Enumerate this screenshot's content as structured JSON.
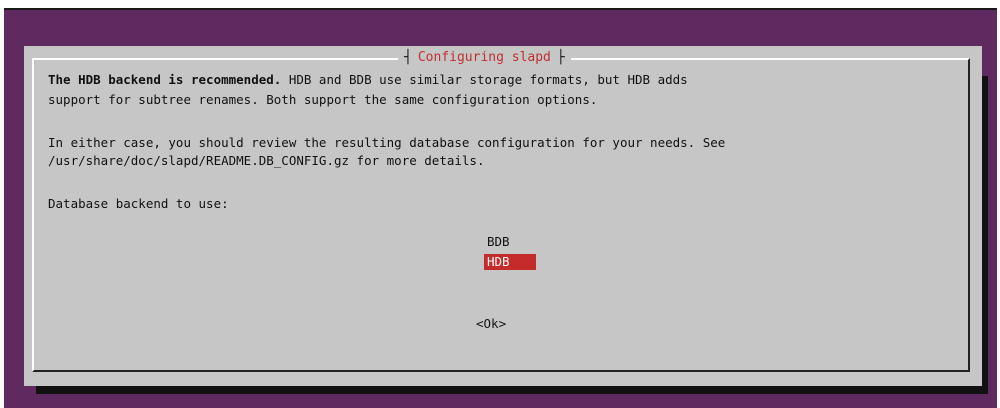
{
  "dialog": {
    "title": "Configuring slapd",
    "paragraph1": {
      "line1_bold": "The HDB backend is recommended.",
      "line1_rest": " HDB and BDB use similar storage formats, but HDB adds",
      "line2": "support for subtree renames. Both support the same configuration options."
    },
    "paragraph2": {
      "line1": "In either case, you should review the resulting database configuration for your needs. See",
      "line2": "/usr/share/doc/slapd/README.DB_CONFIG.gz for more details."
    },
    "prompt": "Database backend to use:",
    "options": [
      {
        "label": "BDB",
        "selected": false
      },
      {
        "label": "HDB",
        "selected": true
      }
    ],
    "ok_button": "<Ok>"
  },
  "colors": {
    "background": "#5e2a60",
    "dialog": "#c6c6c6",
    "title": "#c03030",
    "selection": "#c42b2b"
  }
}
